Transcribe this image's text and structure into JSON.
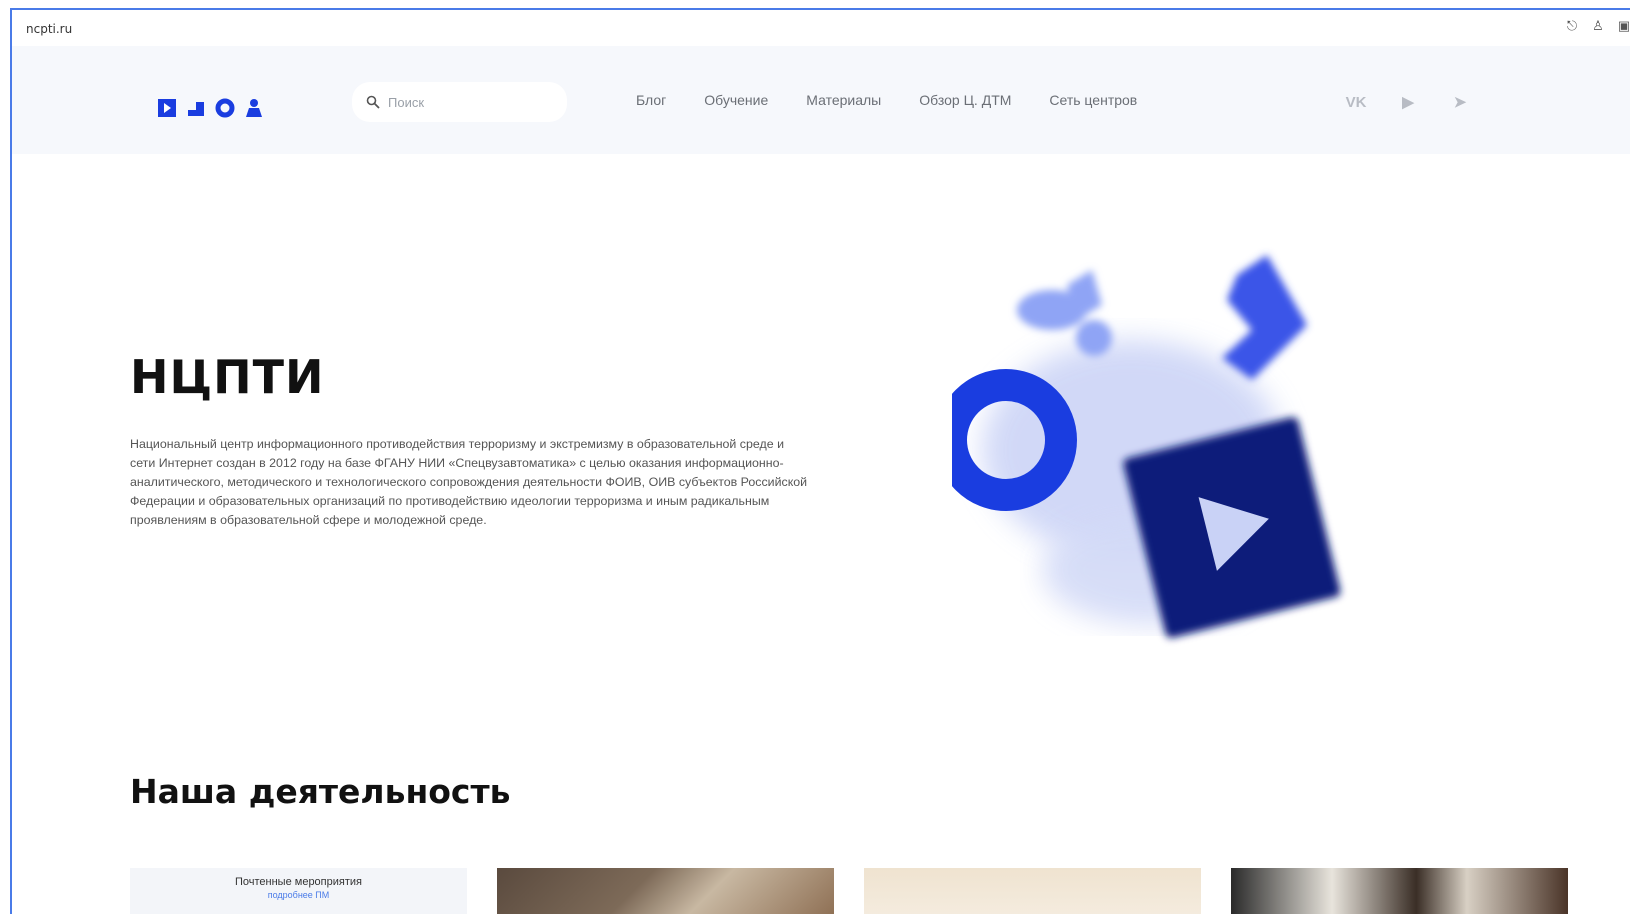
{
  "browser": {
    "url": "ncpti.ru",
    "icons": [
      "account-icon",
      "user-icon",
      "window-icon"
    ]
  },
  "header": {
    "logo_name": "logo-shapes",
    "search": {
      "placeholder": "Поиск"
    },
    "nav": [
      {
        "label": "Блог"
      },
      {
        "label": "Обучение"
      },
      {
        "label": "Материалы"
      },
      {
        "label": "Обзор Ц. ДТМ"
      },
      {
        "label": "Сеть центров"
      }
    ],
    "socials": [
      {
        "icon": "vk-icon",
        "glyph": "VK"
      },
      {
        "icon": "youtube-icon",
        "glyph": "▶"
      },
      {
        "icon": "telegram-icon",
        "glyph": "➤"
      }
    ]
  },
  "hero": {
    "title": "НЦПТИ",
    "text": "Национальный центр информационного противодействия терроризму и экстремизму в образовательной среде и сети Интернет создан в 2012 году на базе ФГАНУ НИИ «Спецвузавтоматика» с целью оказания информационно-аналитического, методического и технологического сопровождения деятельности ФОИВ, ОИВ субъектов Российской Федерации и образовательных организаций по противодействию идеологии терроризма и иным радикальным проявлениям в образовательной сфере и молодежной среде."
  },
  "activity": {
    "title": "Наша деятельность",
    "card1_line1": "Почтенные мероприятия",
    "card1_line2": "подробнее ПМ"
  },
  "colors": {
    "accent": "#1a3de0",
    "navy": "#0b1a7a",
    "light_blue": "#8fa4f5",
    "header_bg": "#f6f8fc",
    "frame": "#4a7be8"
  }
}
